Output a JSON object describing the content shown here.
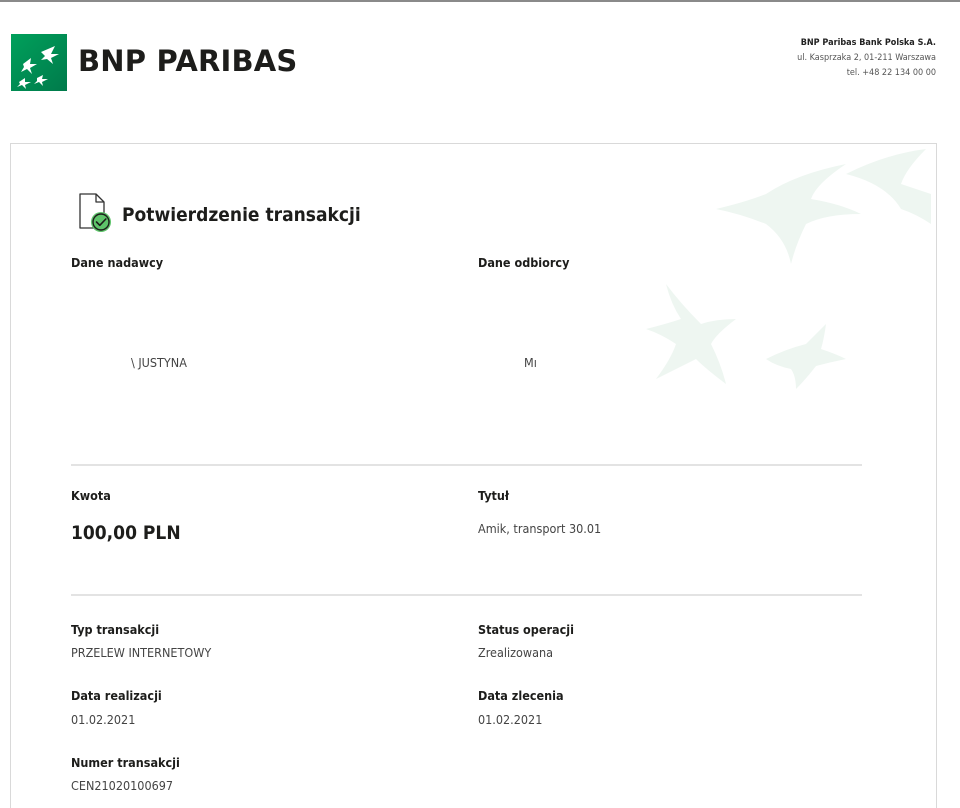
{
  "header": {
    "logo_text": "BNP PARIBAS",
    "bank_name": "BNP Paribas Bank Polska S.A.",
    "address": "ul. Kasprzaka 2, 01-211 Warszawa",
    "phone": "tel. +48 22 134 00 00"
  },
  "document": {
    "title": "Potwierdzenie transakcji",
    "sender": {
      "label": "Dane nadawcy",
      "name": "\\ JUSTYNA"
    },
    "recipient": {
      "label": "Dane odbiorcy",
      "name": "Mı"
    },
    "amount": {
      "label": "Kwota",
      "value": "100,00 PLN"
    },
    "transfer_title": {
      "label": "Tytuł",
      "value": "Amik, transport 30.01"
    },
    "type": {
      "label": "Typ transakcji",
      "value": "PRZELEW INTERNETOWY"
    },
    "status": {
      "label": "Status operacji",
      "value": "Zrealizowana"
    },
    "execution_date": {
      "label": "Data realizacji",
      "value": "01.02.2021"
    },
    "order_date": {
      "label": "Data zlecenia",
      "value": "01.02.2021"
    },
    "transaction_number": {
      "label": "Numer transakcji",
      "value": "CEN21020100697"
    }
  },
  "colors": {
    "brand_green": "#00915a",
    "brand_green_light": "#3fb66e",
    "check_green": "#5ec46a",
    "watermark": "#eef6f1"
  },
  "icons": [
    "bnp-paribas-logo-icon",
    "document-check-icon",
    "stars-watermark-icon"
  ]
}
